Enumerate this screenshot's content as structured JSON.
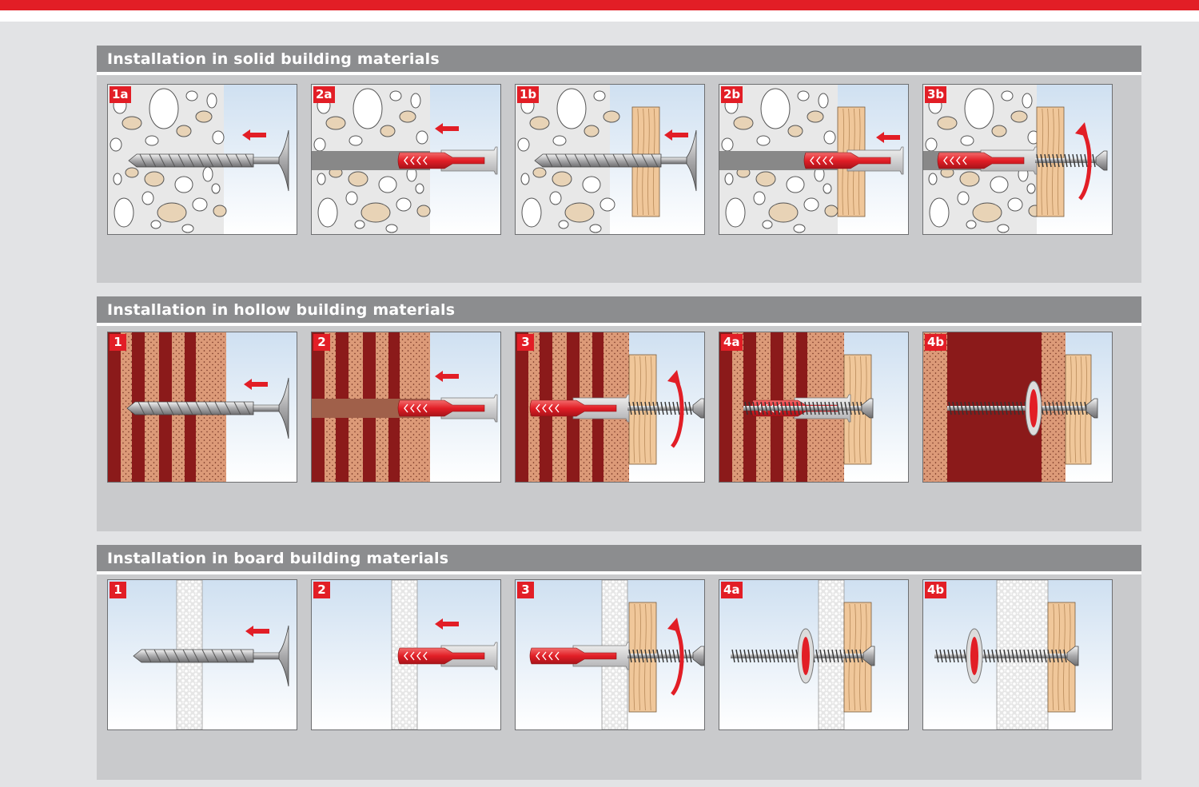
{
  "colors": {
    "brand_red": "#e21e26",
    "section_header": "#8c8d8f",
    "section_bg": "#c9cacc",
    "page_bg": "#e2e3e5"
  },
  "sections": [
    {
      "title": "Installation in solid building materials",
      "material": "solid",
      "steps": [
        {
          "label": "1a",
          "scene": "drill"
        },
        {
          "label": "2a",
          "scene": "insert"
        },
        {
          "label": "1b",
          "scene": "drill-through-wood"
        },
        {
          "label": "2b",
          "scene": "insert-through-wood"
        },
        {
          "label": "3b",
          "scene": "screw"
        }
      ]
    },
    {
      "title": "Installation in hollow building materials",
      "material": "hollow",
      "steps": [
        {
          "label": "1",
          "scene": "drill"
        },
        {
          "label": "2",
          "scene": "insert"
        },
        {
          "label": "3",
          "scene": "screw"
        },
        {
          "label": "4a",
          "scene": "expanded"
        },
        {
          "label": "4b",
          "scene": "knotted"
        }
      ]
    },
    {
      "title": "Installation in board building materials",
      "material": "board",
      "steps": [
        {
          "label": "1",
          "scene": "drill"
        },
        {
          "label": "2",
          "scene": "insert"
        },
        {
          "label": "3",
          "scene": "screw"
        },
        {
          "label": "4a",
          "scene": "expanded"
        },
        {
          "label": "4b",
          "scene": "knotted"
        }
      ]
    }
  ]
}
